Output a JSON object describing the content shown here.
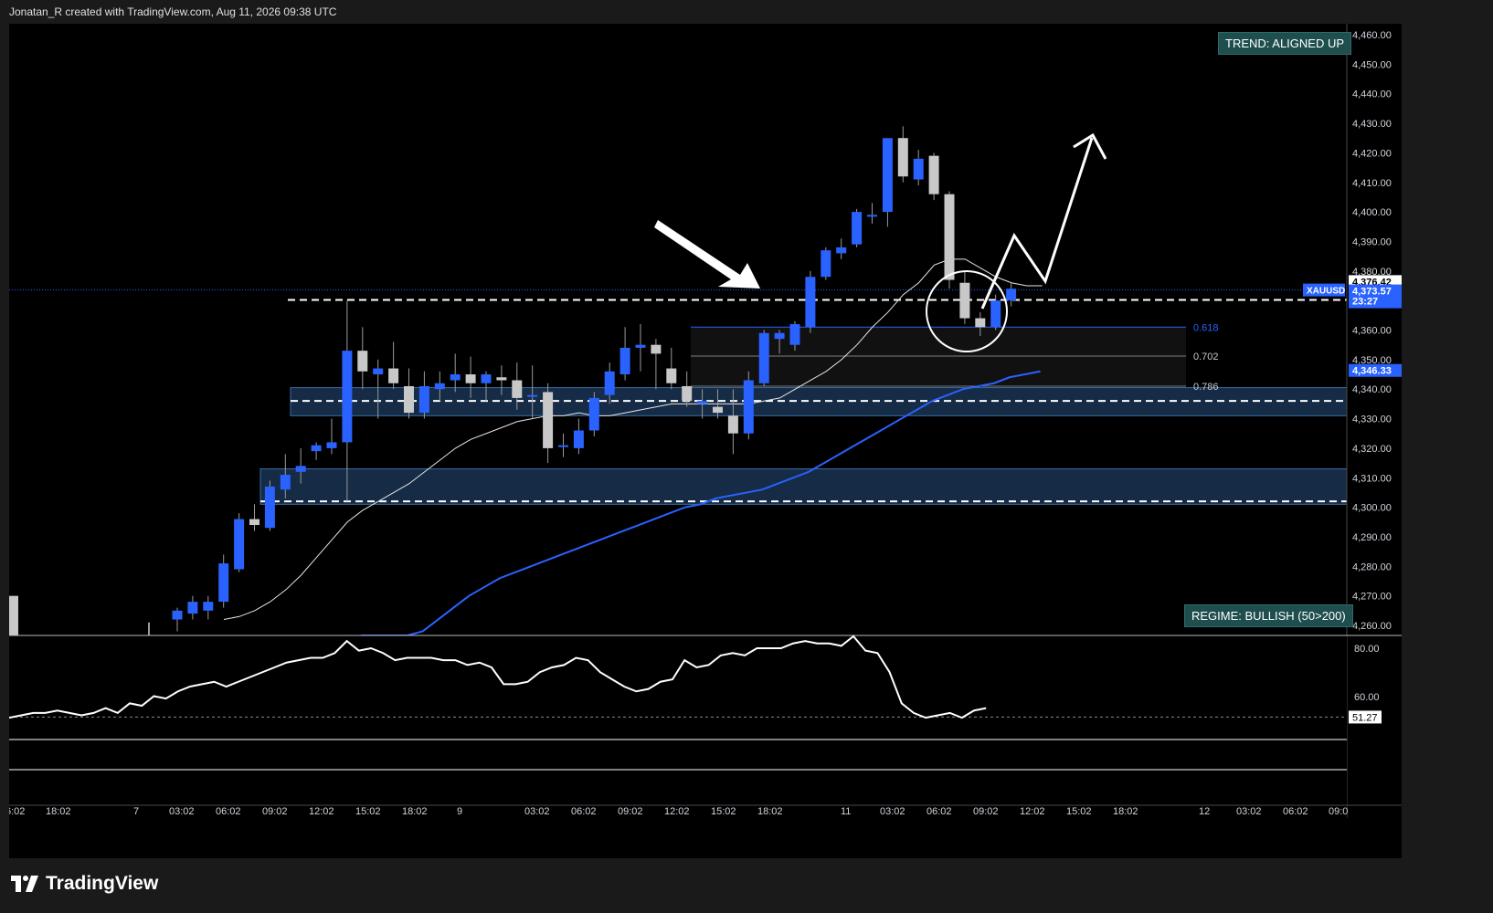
{
  "header": {
    "text": "Jonatan_R created with TradingView.com, Aug 11, 2026 09:38 UTC"
  },
  "brand": {
    "name": "TradingView"
  },
  "badges": {
    "trend": "TREND: ALIGNED UP",
    "regime": "REGIME: BULLISH (50>200)"
  },
  "price_axis": {
    "ticks": [
      "4,460.00",
      "4,450.00",
      "4,440.00",
      "4,430.00",
      "4,420.00",
      "4,410.00",
      "4,400.00",
      "4,390.00",
      "4,380.00",
      "4,370.00",
      "4,360.00",
      "4,350.00",
      "4,340.00",
      "4,330.00",
      "4,320.00",
      "4,310.00",
      "4,300.00",
      "4,290.00",
      "4,280.00",
      "4,270.00",
      "4,260.00"
    ],
    "labels": {
      "high": "4,376.42",
      "symbol": "XAUUSD",
      "last": "4,373.57",
      "countdown": "23:27",
      "ma": "4,346.33"
    }
  },
  "fib": {
    "levels": [
      "0.618",
      "0.702",
      "0.786"
    ]
  },
  "rsi_axis": {
    "ticks": [
      "80.00",
      "60.00"
    ],
    "value": "51.27"
  },
  "time_axis": {
    "labels": [
      "6:02",
      "18:02",
      "7",
      "03:02",
      "06:02",
      "09:02",
      "12:02",
      "15:02",
      "18:02",
      "9",
      "03:02",
      "06:02",
      "09:02",
      "12:02",
      "15:02",
      "18:02",
      "11",
      "03:02",
      "06:02",
      "09:02",
      "12:02",
      "15:02",
      "18:02",
      "12",
      "03:02",
      "06:02",
      "09:0"
    ]
  },
  "colors": {
    "up": "#2962ff",
    "down": "#c8c8c8",
    "ma_fast": "#e6e6e6",
    "ma_slow": "#2962ff",
    "zone": "#1d3a5c",
    "badge": "#1f4e4e"
  },
  "chart_data": {
    "type": "candlestick",
    "symbol": "XAUUSD",
    "candles": [
      {
        "o": 4262,
        "h": 4266,
        "l": 4258,
        "c": 4265
      },
      {
        "o": 4264,
        "h": 4270,
        "l": 4262,
        "c": 4268
      },
      {
        "o": 4265,
        "h": 4270,
        "l": 4262,
        "c": 4268
      },
      {
        "o": 4268,
        "h": 4284,
        "l": 4266,
        "c": 4281
      },
      {
        "o": 4279,
        "h": 4298,
        "l": 4278,
        "c": 4296
      },
      {
        "o": 4296,
        "h": 4301,
        "l": 4292,
        "c": 4294
      },
      {
        "o": 4293,
        "h": 4309,
        "l": 4292,
        "c": 4307
      },
      {
        "o": 4306,
        "h": 4318,
        "l": 4303,
        "c": 4311
      },
      {
        "o": 4312,
        "h": 4320,
        "l": 4308,
        "c": 4314
      },
      {
        "o": 4319,
        "h": 4322,
        "l": 4316,
        "c": 4321
      },
      {
        "o": 4320,
        "h": 4330,
        "l": 4318,
        "c": 4322
      },
      {
        "o": 4322,
        "h": 4370,
        "l": 4302,
        "c": 4353
      },
      {
        "o": 4353,
        "h": 4361,
        "l": 4340,
        "c": 4346
      },
      {
        "o": 4345,
        "h": 4350,
        "l": 4330,
        "c": 4347
      },
      {
        "o": 4347,
        "h": 4356,
        "l": 4340,
        "c": 4342
      },
      {
        "o": 4341,
        "h": 4347,
        "l": 4330,
        "c": 4332
      },
      {
        "o": 4332,
        "h": 4346,
        "l": 4330,
        "c": 4341
      },
      {
        "o": 4340,
        "h": 4346,
        "l": 4336,
        "c": 4342
      },
      {
        "o": 4343,
        "h": 4352,
        "l": 4339,
        "c": 4345
      },
      {
        "o": 4345,
        "h": 4351,
        "l": 4337,
        "c": 4342
      },
      {
        "o": 4342,
        "h": 4346,
        "l": 4336,
        "c": 4345
      },
      {
        "o": 4344,
        "h": 4348,
        "l": 4338,
        "c": 4343
      },
      {
        "o": 4343,
        "h": 4349,
        "l": 4333,
        "c": 4337
      },
      {
        "o": 4338,
        "h": 4348,
        "l": 4330,
        "c": 4338
      },
      {
        "o": 4339,
        "h": 4342,
        "l": 4315,
        "c": 4320
      },
      {
        "o": 4321,
        "h": 4325,
        "l": 4317,
        "c": 4321
      },
      {
        "o": 4320,
        "h": 4330,
        "l": 4318,
        "c": 4326
      },
      {
        "o": 4326,
        "h": 4339,
        "l": 4324,
        "c": 4337
      },
      {
        "o": 4338,
        "h": 4349,
        "l": 4335,
        "c": 4346
      },
      {
        "o": 4345,
        "h": 4361,
        "l": 4343,
        "c": 4354
      },
      {
        "o": 4354,
        "h": 4362,
        "l": 4346,
        "c": 4355
      },
      {
        "o": 4355,
        "h": 4357,
        "l": 4340,
        "c": 4352
      },
      {
        "o": 4347,
        "h": 4354,
        "l": 4340,
        "c": 4342
      },
      {
        "o": 4341,
        "h": 4346,
        "l": 4334,
        "c": 4336
      },
      {
        "o": 4335,
        "h": 4340,
        "l": 4330,
        "c": 4336
      },
      {
        "o": 4334,
        "h": 4340,
        "l": 4330,
        "c": 4332
      },
      {
        "o": 4331,
        "h": 4340,
        "l": 4318,
        "c": 4325
      },
      {
        "o": 4325,
        "h": 4346,
        "l": 4323,
        "c": 4343
      },
      {
        "o": 4342,
        "h": 4360,
        "l": 4341,
        "c": 4359
      },
      {
        "o": 4357,
        "h": 4360,
        "l": 4352,
        "c": 4359
      },
      {
        "o": 4355,
        "h": 4363,
        "l": 4353,
        "c": 4362
      },
      {
        "o": 4361,
        "h": 4380,
        "l": 4359,
        "c": 4378
      },
      {
        "o": 4378,
        "h": 4388,
        "l": 4377,
        "c": 4387
      },
      {
        "o": 4386,
        "h": 4391,
        "l": 4384,
        "c": 4388
      },
      {
        "o": 4389,
        "h": 4401,
        "l": 4388,
        "c": 4400
      },
      {
        "o": 4399,
        "h": 4403,
        "l": 4396,
        "c": 4399
      },
      {
        "o": 4400,
        "h": 4424,
        "l": 4395,
        "c": 4425
      },
      {
        "o": 4425,
        "h": 4429,
        "l": 4410,
        "c": 4412
      },
      {
        "o": 4411,
        "h": 4421,
        "l": 4409,
        "c": 4418
      },
      {
        "o": 4419,
        "h": 4420,
        "l": 4404,
        "c": 4406
      },
      {
        "o": 4406,
        "h": 4407,
        "l": 4374,
        "c": 4377
      },
      {
        "o": 4376,
        "h": 4380,
        "l": 4362,
        "c": 4364
      },
      {
        "o": 4364,
        "h": 4366,
        "l": 4358,
        "c": 4361
      },
      {
        "o": 4361,
        "h": 4372,
        "l": 4360,
        "c": 4370
      },
      {
        "o": 4370,
        "h": 4376,
        "l": 4368,
        "c": 4374
      }
    ],
    "ma_fast": [
      4262,
      4263,
      4265,
      4268,
      4272,
      4277,
      4283,
      4289,
      4295,
      4299,
      4302,
      4305,
      4308,
      4312,
      4316,
      4320,
      4323,
      4325,
      4327,
      4329,
      4330,
      4331,
      4331,
      4332,
      4331,
      4331,
      4332,
      4333,
      4334,
      4335,
      4335,
      4335,
      4335,
      4335,
      4335,
      4336,
      4337,
      4340,
      4343,
      4346,
      4350,
      4355,
      4361,
      4366,
      4372,
      4376,
      4382,
      4384,
      4384,
      4381,
      4378,
      4376,
      4375,
      4375
    ],
    "ma_slow": [
      4245,
      4248,
      4251,
      4254,
      4258,
      4262,
      4266,
      4270,
      4273,
      4276,
      4278,
      4280,
      4282,
      4284,
      4286,
      4288,
      4290,
      4292,
      4294,
      4296,
      4298,
      4300,
      4301,
      4303,
      4304,
      4305,
      4306,
      4308,
      4310,
      4312,
      4315,
      4318,
      4321,
      4324,
      4327,
      4330,
      4333,
      4336,
      4338,
      4340,
      4341,
      4342,
      4344,
      4345,
      4346
    ],
    "rsi": [
      51,
      52,
      53,
      53,
      54,
      53,
      52,
      53,
      55,
      53,
      57,
      56,
      60,
      59,
      62,
      64,
      65,
      66,
      64,
      66,
      68,
      70,
      72,
      74,
      75,
      76,
      76,
      78,
      83,
      79,
      80,
      78,
      75,
      76,
      76,
      76,
      75,
      75,
      73,
      74,
      72,
      65,
      65,
      66,
      70,
      72,
      73,
      76,
      75,
      70,
      67,
      64,
      62,
      63,
      66,
      67,
      75,
      72,
      73,
      77,
      78,
      77,
      80,
      80,
      80,
      82,
      83,
      82,
      82,
      81,
      85,
      79,
      78,
      70,
      57,
      53,
      51,
      52,
      53,
      51,
      54,
      55
    ],
    "fib_levels": [
      0.618,
      0.702,
      0.786
    ],
    "price_ylim": [
      4256,
      4462
    ]
  }
}
